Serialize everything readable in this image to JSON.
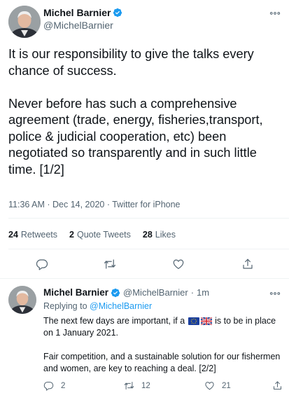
{
  "main_tweet": {
    "display_name": "Michel Barnier",
    "handle": "@MichelBarnier",
    "paragraph_1": "It is our responsibility to give the talks every chance of success.",
    "paragraph_2": "Never before has such a comprehensive agreement (trade, energy, fisheries,transport, police & judicial cooperation, etc) been negotiated so transparently and in such little time. [1/2]",
    "timestamp": "11:36 AM · Dec 14, 2020 · Twitter for iPhone",
    "stats": {
      "retweets_count": "24",
      "retweets_label": "Retweets",
      "quotes_count": "2",
      "quotes_label": "Quote Tweets",
      "likes_count": "28",
      "likes_label": "Likes"
    },
    "actions": [
      "reply-icon",
      "retweet-icon",
      "like-icon",
      "share-icon"
    ]
  },
  "reply_tweet": {
    "display_name": "Michel Barnier",
    "handle": "@MichelBarnier",
    "separator": "·",
    "time": "1m",
    "replying_prefix": "Replying to",
    "replying_handle": "@MichelBarnier",
    "text_before_flags": "The next few days are important, if a",
    "text_after_flags": "is to be in place on 1 January 2021.",
    "paragraph_2": "Fair competition, and a sustainable solution for our fishermen and women, are key to reaching a deal. [2/2]",
    "reply_count": "2",
    "retweet_count": "12",
    "like_count": "21"
  },
  "colors": {
    "accent": "#1d9bf0",
    "text": "#0f1419",
    "secondary": "#536471",
    "divider": "#eff3f4"
  }
}
